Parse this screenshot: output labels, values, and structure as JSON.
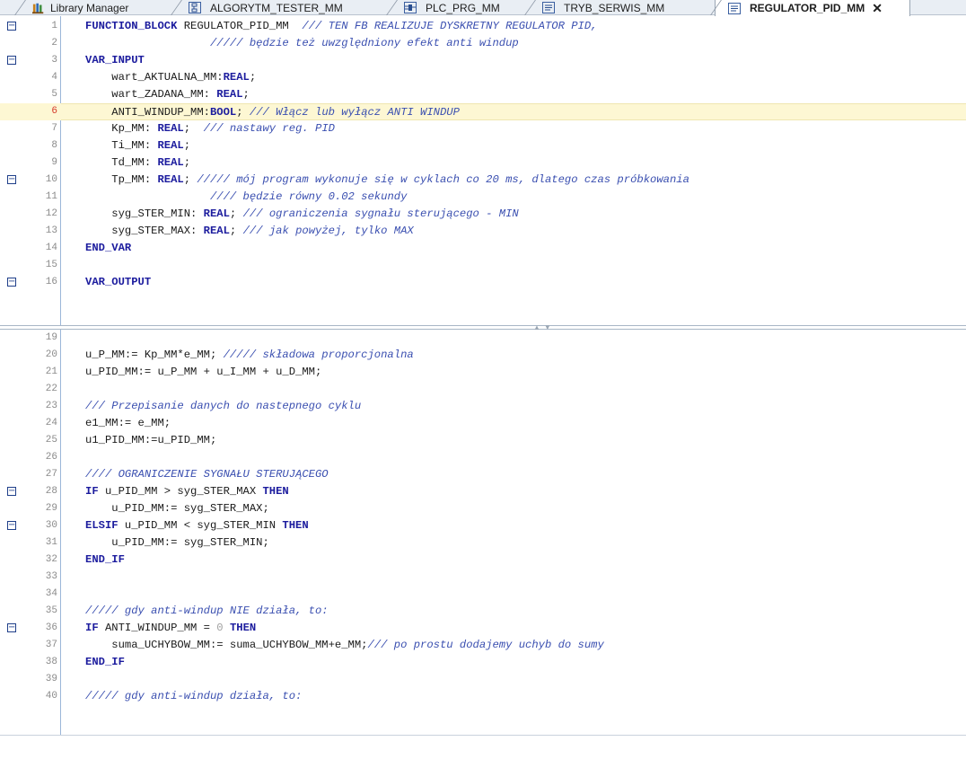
{
  "tabs": [
    {
      "label": "Library Manager",
      "icon": "library-icon",
      "active": false
    },
    {
      "label": "ALGORYTM_TESTER_MM",
      "icon": "sfc-icon",
      "active": false
    },
    {
      "label": "PLC_PRG_MM",
      "icon": "fbd-icon",
      "active": false
    },
    {
      "label": "TRYB_SERWIS_MM",
      "icon": "st-document-icon",
      "active": false
    },
    {
      "label": "REGULATOR_PID_MM",
      "icon": "st-document-icon",
      "active": true,
      "close": "✕"
    }
  ],
  "colors": {
    "keyword": "#1c1c9e",
    "comment": "#3a4fb0",
    "number": "#a0a0a0",
    "current_line": "#fdf7d3",
    "current_line_number": "#d43a2a"
  },
  "declaration_pane": {
    "lines": [
      {
        "num": "1",
        "fold": "⊟",
        "tokens": [
          [
            "kw",
            "FUNCTION_BLOCK"
          ],
          [
            "tx",
            " REGULATOR_PID_MM  "
          ],
          [
            "cm",
            "/// TEN FB REALIZUJE DYSKRETNY REGULATOR PID,"
          ]
        ]
      },
      {
        "num": "2",
        "tokens": [
          [
            "tx",
            "                   "
          ],
          [
            "cm",
            "///// będzie też uwzględniony efekt anti windup"
          ]
        ]
      },
      {
        "num": "3",
        "fold": "⊟",
        "tokens": [
          [
            "kw",
            "VAR_INPUT"
          ]
        ]
      },
      {
        "num": "4",
        "tokens": [
          [
            "tx",
            "    wart_AKTUALNA_MM:"
          ],
          [
            "kw",
            "REAL"
          ],
          [
            "tx",
            ";"
          ]
        ]
      },
      {
        "num": "5",
        "tokens": [
          [
            "tx",
            "    wart_ZADANA_MM: "
          ],
          [
            "kw",
            "REAL"
          ],
          [
            "tx",
            ";"
          ]
        ]
      },
      {
        "num": "6",
        "current": true,
        "tokens": [
          [
            "tx",
            "    ANTI_WINDUP_MM:"
          ],
          [
            "kw",
            "BOOL"
          ],
          [
            "tx",
            "; "
          ],
          [
            "cm",
            "/// Włącz lub wyłącz ANTI WINDUP"
          ]
        ]
      },
      {
        "num": "7",
        "tokens": [
          [
            "tx",
            "    Kp_MM: "
          ],
          [
            "kw",
            "REAL"
          ],
          [
            "tx",
            ";  "
          ],
          [
            "cm",
            "/// nastawy reg. PID"
          ]
        ]
      },
      {
        "num": "8",
        "tokens": [
          [
            "tx",
            "    Ti_MM: "
          ],
          [
            "kw",
            "REAL"
          ],
          [
            "tx",
            ";"
          ]
        ]
      },
      {
        "num": "9",
        "tokens": [
          [
            "tx",
            "    Td_MM: "
          ],
          [
            "kw",
            "REAL"
          ],
          [
            "tx",
            ";"
          ]
        ]
      },
      {
        "num": "10",
        "fold": "⊟",
        "tokens": [
          [
            "tx",
            "    Tp_MM: "
          ],
          [
            "kw",
            "REAL"
          ],
          [
            "tx",
            "; "
          ],
          [
            "cm",
            "///// mój program wykonuje się w cyklach co 20 ms, dlatego czas próbkowania"
          ]
        ]
      },
      {
        "num": "11",
        "tokens": [
          [
            "tx",
            "                   "
          ],
          [
            "cm",
            "//// będzie równy 0.02 sekundy"
          ]
        ]
      },
      {
        "num": "12",
        "tokens": [
          [
            "tx",
            "    syg_STER_MIN: "
          ],
          [
            "kw",
            "REAL"
          ],
          [
            "tx",
            "; "
          ],
          [
            "cm",
            "/// ograniczenia sygnału sterującego - MIN"
          ]
        ]
      },
      {
        "num": "13",
        "tokens": [
          [
            "tx",
            "    syg_STER_MAX: "
          ],
          [
            "kw",
            "REAL"
          ],
          [
            "tx",
            "; "
          ],
          [
            "cm",
            "/// jak powyżej, tylko MAX"
          ]
        ]
      },
      {
        "num": "14",
        "tokens": [
          [
            "kw",
            "END_VAR"
          ]
        ]
      },
      {
        "num": "15",
        "tokens": []
      },
      {
        "num": "16",
        "fold": "⊟",
        "tokens": [
          [
            "kw",
            "VAR_OUTPUT"
          ]
        ]
      }
    ]
  },
  "implementation_pane": {
    "lines": [
      {
        "num": "19",
        "tokens": []
      },
      {
        "num": "20",
        "tokens": [
          [
            "tx",
            "u_P_MM:= Kp_MM*e_MM; "
          ],
          [
            "cm",
            "///// składowa proporcjonalna"
          ]
        ]
      },
      {
        "num": "21",
        "tokens": [
          [
            "tx",
            "u_PID_MM:= u_P_MM + u_I_MM + u_D_MM;"
          ]
        ]
      },
      {
        "num": "22",
        "tokens": []
      },
      {
        "num": "23",
        "tokens": [
          [
            "cm",
            "/// Przepisanie danych do nastepnego cyklu"
          ]
        ]
      },
      {
        "num": "24",
        "tokens": [
          [
            "tx",
            "e1_MM:= e_MM;"
          ]
        ]
      },
      {
        "num": "25",
        "tokens": [
          [
            "tx",
            "u1_PID_MM:=u_PID_MM;"
          ]
        ]
      },
      {
        "num": "26",
        "tokens": []
      },
      {
        "num": "27",
        "tokens": [
          [
            "cm",
            "//// OGRANICZENIE SYGNAŁU STERUJĄCEGO"
          ]
        ]
      },
      {
        "num": "28",
        "fold": "⊟",
        "tokens": [
          [
            "kw",
            "IF"
          ],
          [
            "tx",
            " u_PID_MM > syg_STER_MAX "
          ],
          [
            "kw",
            "THEN"
          ]
        ]
      },
      {
        "num": "29",
        "tokens": [
          [
            "tx",
            "    u_PID_MM:= syg_STER_MAX;"
          ]
        ]
      },
      {
        "num": "30",
        "fold": "⊟",
        "tokens": [
          [
            "kw",
            "ELSIF"
          ],
          [
            "tx",
            " u_PID_MM < syg_STER_MIN "
          ],
          [
            "kw",
            "THEN"
          ]
        ]
      },
      {
        "num": "31",
        "tokens": [
          [
            "tx",
            "    u_PID_MM:= syg_STER_MIN;"
          ]
        ]
      },
      {
        "num": "32",
        "tokens": [
          [
            "kw",
            "END_IF"
          ]
        ]
      },
      {
        "num": "33",
        "tokens": []
      },
      {
        "num": "34",
        "tokens": []
      },
      {
        "num": "35",
        "tokens": [
          [
            "cm",
            "///// gdy anti-windup NIE działa, to:"
          ]
        ]
      },
      {
        "num": "36",
        "fold": "⊟",
        "tokens": [
          [
            "kw",
            "IF"
          ],
          [
            "tx",
            " ANTI_WINDUP_MM = "
          ],
          [
            "num",
            "0"
          ],
          [
            "tx",
            " "
          ],
          [
            "kw",
            "THEN"
          ]
        ]
      },
      {
        "num": "37",
        "tokens": [
          [
            "tx",
            "    suma_UCHYBOW_MM:= suma_UCHYBOW_MM+e_MM;"
          ],
          [
            "cm",
            "/// po prostu dodajemy uchyb do sumy"
          ]
        ]
      },
      {
        "num": "38",
        "tokens": [
          [
            "kw",
            "END_IF"
          ]
        ]
      },
      {
        "num": "39",
        "tokens": []
      },
      {
        "num": "40",
        "tokens": [
          [
            "cm",
            "///// gdy anti-windup działa, to:"
          ]
        ]
      }
    ]
  }
}
